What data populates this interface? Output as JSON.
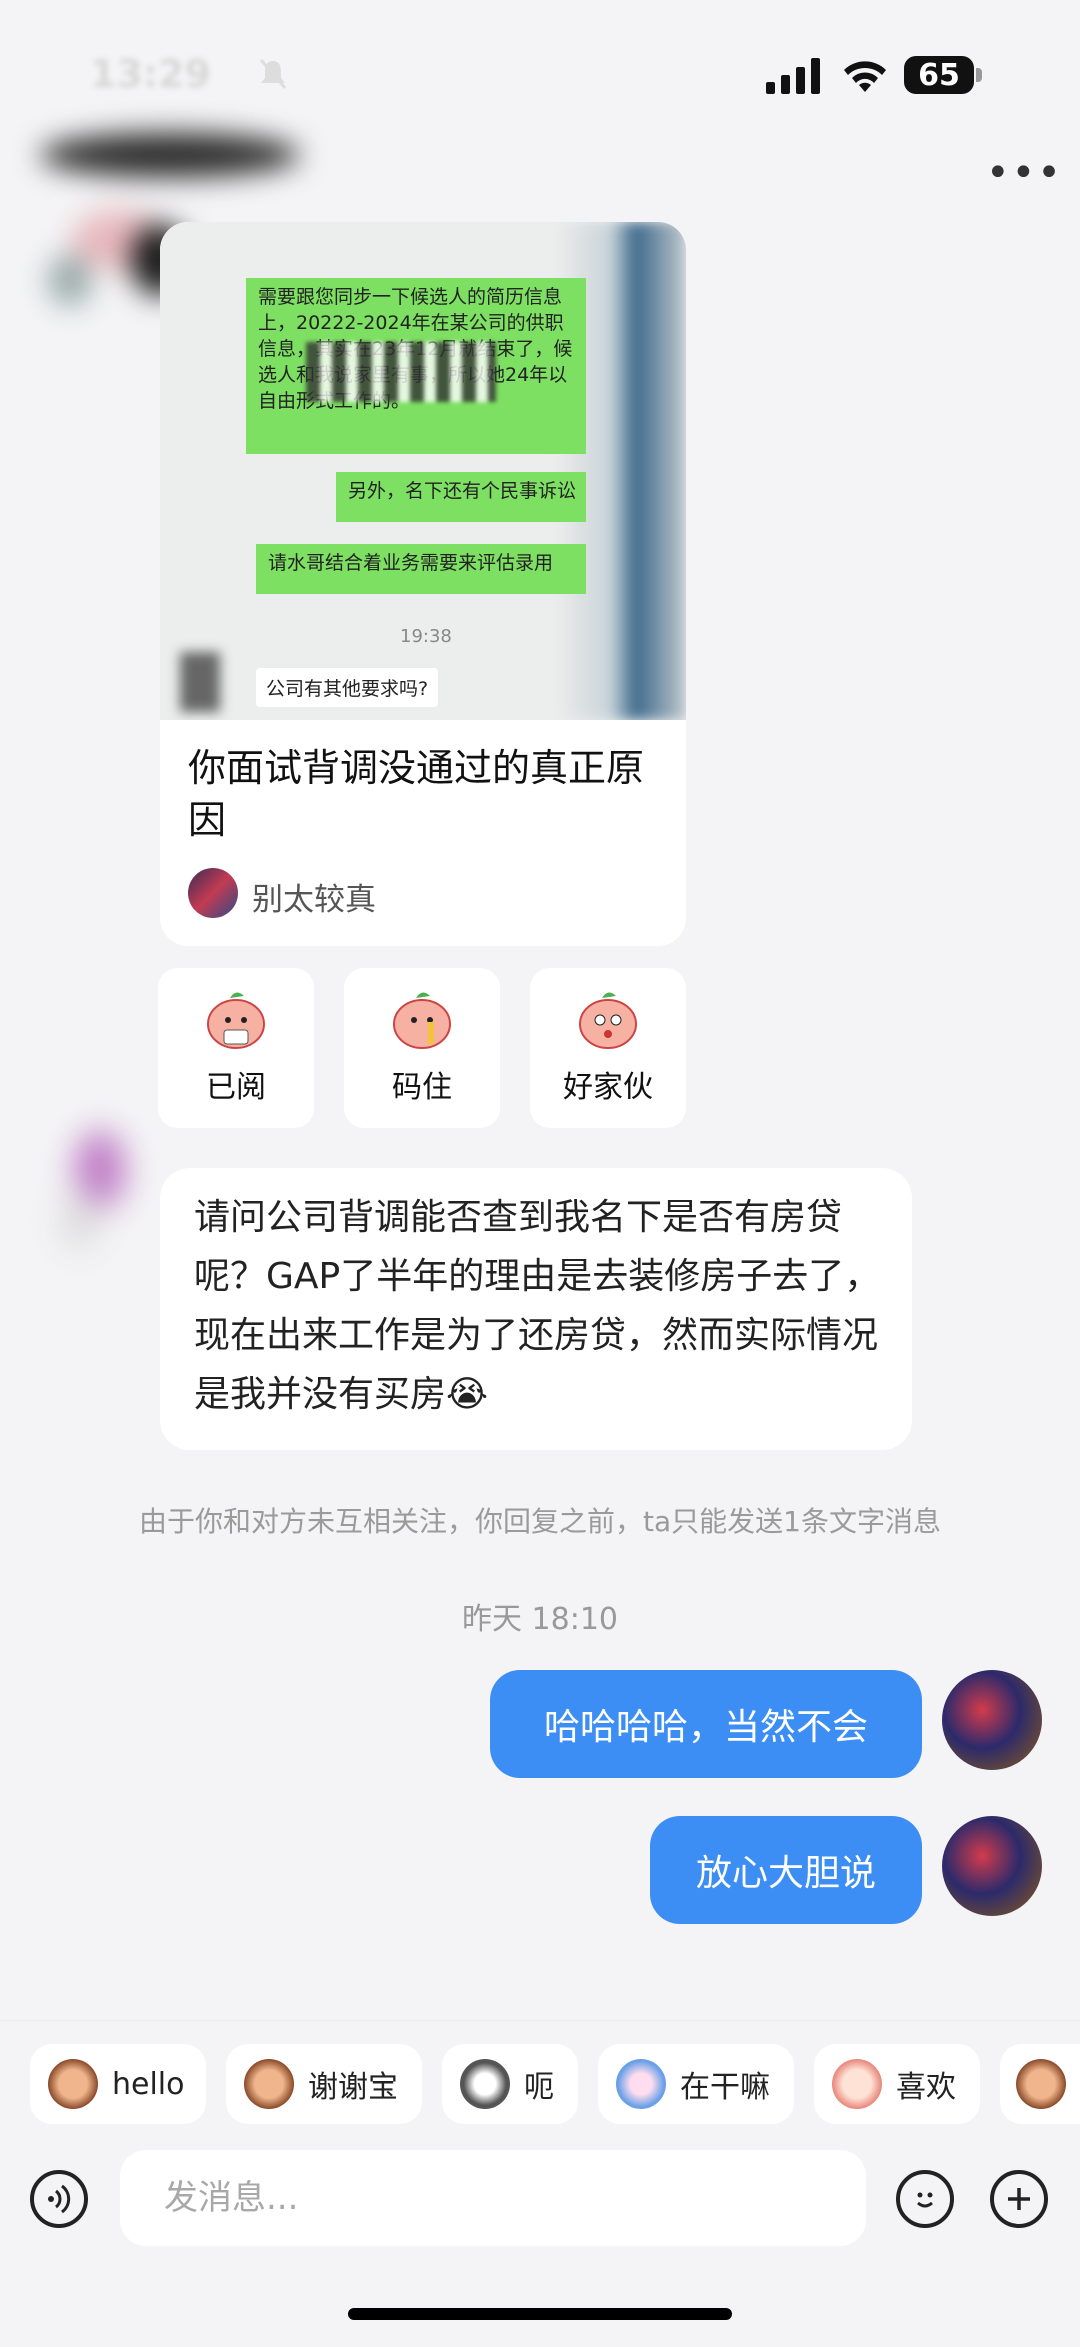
{
  "status_bar": {
    "time": "13:29",
    "battery": "65"
  },
  "shared_card": {
    "image": {
      "msg1": "需要跟您同步一下候选人的简历信息上，20222-2024年在某公司的供职信息，其实在23年12月就结束了，候选人和我说家里有事，所以她24年以自由形式工作的。",
      "msg2": "另外，名下还有个民事诉讼",
      "msg3": "请水哥结合着业务需要来评估录用",
      "time": "19:38",
      "msg4": "公司有其他要求吗?"
    },
    "title": "你面试背调没通过的真正原因",
    "author": "别太较真"
  },
  "reactions": [
    {
      "label": "已阅"
    },
    {
      "label": "码住"
    },
    {
      "label": "好家伙"
    }
  ],
  "received_message": "请问公司背调能否查到我名下是否有房贷呢？GAP了半年的理由是去装修房子去了，现在出来工作是为了还房贷，然而实际情况是我并没有买房😭",
  "notice": "由于你和对方未互相关注，你回复之前，ta只能发送1条文字消息",
  "timestamp": "昨天 18:10",
  "sent_messages": [
    {
      "text": "哈哈哈哈，当然不会"
    },
    {
      "text": "放心大胆说"
    }
  ],
  "quick_replies": [
    {
      "label": "hello",
      "icon": "monkey-icon"
    },
    {
      "label": "谢谢宝",
      "icon": "monkey-rose-icon"
    },
    {
      "label": "呃",
      "icon": "cat-icon"
    },
    {
      "label": "在干嘛",
      "icon": "peek-icon"
    },
    {
      "label": "喜欢",
      "icon": "heart-eyes-icon"
    }
  ],
  "input": {
    "placeholder": "发消息..."
  }
}
